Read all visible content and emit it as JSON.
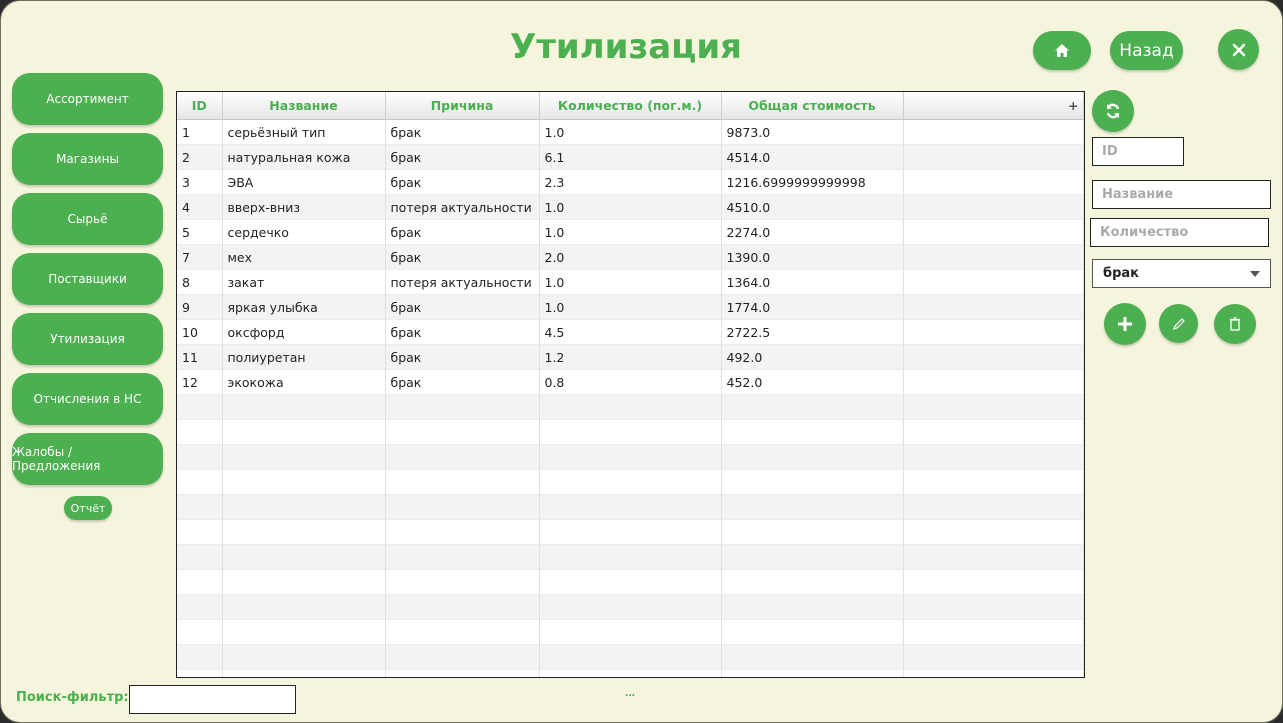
{
  "title": "Утилизация",
  "header": {
    "home_icon": "home-icon",
    "back_label": "Назад",
    "close_icon": "close-icon"
  },
  "sidebar": {
    "items": [
      {
        "label": "Ассортимент"
      },
      {
        "label": "Магазины"
      },
      {
        "label": "Сырьё"
      },
      {
        "label": "Поставщики"
      },
      {
        "label": "Утилизация"
      },
      {
        "label": "Отчисления в НС"
      },
      {
        "label": "Жалобы / Предложения"
      }
    ],
    "report_label": "Отчёт"
  },
  "table": {
    "columns": [
      "ID",
      "Название",
      "Причина",
      "Количество (пог.м.)",
      "Общая стоимость"
    ],
    "rows": [
      [
        "1",
        "серьёзный тип",
        "брак",
        "1.0",
        "9873.0"
      ],
      [
        "2",
        "натуральная кожа",
        "брак",
        "6.1",
        "4514.0"
      ],
      [
        "3",
        "ЭВА",
        "брак",
        "2.3",
        "1216.6999999999998"
      ],
      [
        "4",
        "вверх-вниз",
        "потеря актуальности",
        "1.0",
        "4510.0"
      ],
      [
        "5",
        "сердечко",
        "брак",
        "1.0",
        "2274.0"
      ],
      [
        "7",
        "мех",
        "брак",
        "2.0",
        "1390.0"
      ],
      [
        "8",
        "закат",
        "потеря актуальности",
        "1.0",
        "1364.0"
      ],
      [
        "9",
        "яркая улыбка",
        "брак",
        "1.0",
        "1774.0"
      ],
      [
        "10",
        "оксфорд",
        "брак",
        "4.5",
        "2722.5"
      ],
      [
        "11",
        "полиуретан",
        "брак",
        "1.2",
        "492.0"
      ],
      [
        "12",
        "экокожа",
        "брак",
        "0.8",
        "452.0"
      ]
    ],
    "column_menu_glyph": "+"
  },
  "form": {
    "refresh_icon": "refresh-icon",
    "id_placeholder": "ID",
    "name_placeholder": "Название",
    "qty_placeholder": "Количество",
    "reason_selected": "брак",
    "add_icon": "plus-icon",
    "edit_icon": "pencil-icon",
    "delete_icon": "trash-icon"
  },
  "footer": {
    "filter_label": "Поиск-фильтр:",
    "filter_value": "",
    "status_text": "..."
  },
  "colors": {
    "accent": "#4caf50",
    "background": "#f5f4dc"
  }
}
